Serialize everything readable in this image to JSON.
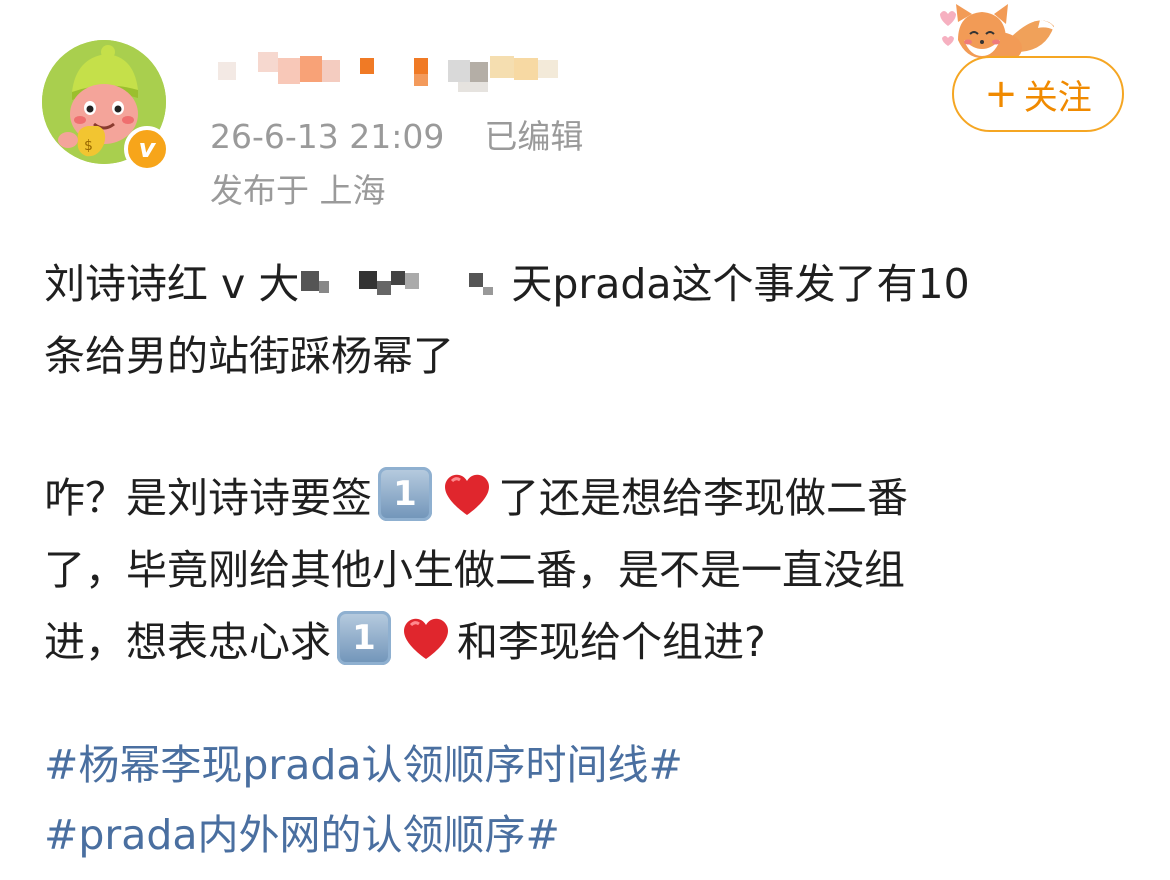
{
  "user": {
    "avatar_badge": "v",
    "brand_color": "#f5a623"
  },
  "meta": {
    "timestamp": "26-6-13 21:09",
    "edited": "已编辑",
    "location": "发布于 上海"
  },
  "follow": {
    "plus": "+",
    "label": "关注"
  },
  "post": {
    "line1_a": "刘诗诗红 v 大",
    "line1_b": "天prada这个事发了有10",
    "line2": "条给男的站街踩杨幂了",
    "p2_line1_a": "咋？是刘诗诗要签",
    "p2_line1_b": "了还是想给李现做二番",
    "p2_line2": "了，毕竟刚给其他小生做二番，是不是一直没组",
    "p2_line3_a": "进，想表忠心求",
    "p2_line3_b": "和李现给个组进?",
    "emoji_key_digit": "1"
  },
  "hashtags": [
    "#杨幂李现prada认领顺序时间线#",
    "#prada内外网的认领顺序#"
  ],
  "colors": {
    "text": "#1f1f1f",
    "meta": "#9a9a9a",
    "hashtag": "#4a6fa0",
    "follow": "#f08a00"
  }
}
